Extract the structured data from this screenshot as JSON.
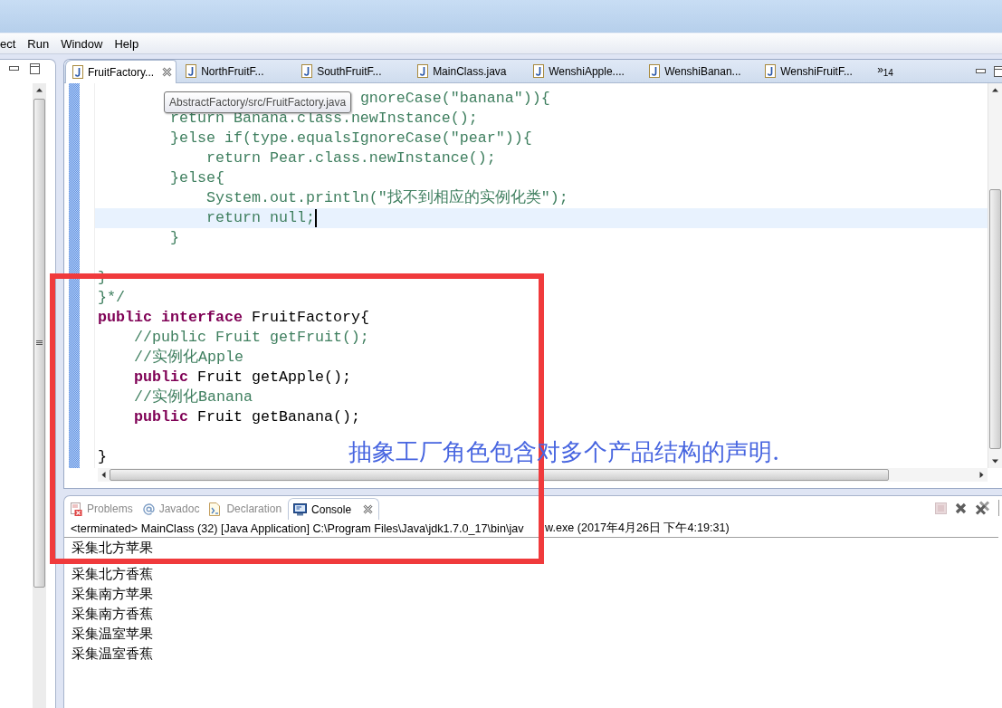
{
  "menu": [
    {
      "label": "ect"
    },
    {
      "label": "Run"
    },
    {
      "label": "Window"
    },
    {
      "label": "Help"
    }
  ],
  "editor": {
    "tabs": [
      {
        "label": "FruitFactory...",
        "selected": true
      },
      {
        "label": "NorthFruitF...",
        "selected": false
      },
      {
        "label": "SouthFruitF...",
        "selected": false
      },
      {
        "label": "MainClass.java",
        "selected": false
      },
      {
        "label": "WenshiApple....",
        "selected": false
      },
      {
        "label": "WenshiBanan...",
        "selected": false
      },
      {
        "label": "WenshiFruitF...",
        "selected": false
      }
    ],
    "overflow": "»$_{14}$",
    "tooltip": "AbstractFactory/src/FruitFactory.java",
    "lines": [
      {
        "highlighted": false,
        "tokens": [
          {
            "kind": "comment",
            "text": "                             gnoreCase(\"banana\")){"
          }
        ]
      },
      {
        "highlighted": false,
        "tokens": [
          {
            "kind": "comment",
            "text": "        return Banana.class.newInstance();"
          }
        ]
      },
      {
        "highlighted": false,
        "tokens": [
          {
            "kind": "comment",
            "text": "        }else if(type.equalsIgnoreCase(\"pear\")){"
          }
        ]
      },
      {
        "highlighted": false,
        "tokens": [
          {
            "kind": "comment",
            "text": "            return Pear.class.newInstance();"
          }
        ]
      },
      {
        "highlighted": false,
        "tokens": [
          {
            "kind": "comment",
            "text": "        }else{"
          }
        ]
      },
      {
        "highlighted": false,
        "tokens": [
          {
            "kind": "comment",
            "text": "            System.out.println(\"找不到相应的实例化类\");"
          }
        ]
      },
      {
        "highlighted": true,
        "tokens": [
          {
            "kind": "comment",
            "text": "            return null;"
          }
        ]
      },
      {
        "highlighted": false,
        "tokens": [
          {
            "kind": "comment",
            "text": "        }"
          }
        ]
      },
      {
        "highlighted": false
      },
      {
        "highlighted": false,
        "tokens": [
          {
            "kind": "comment",
            "text": "}"
          }
        ]
      },
      {
        "highlighted": false,
        "tokens": [
          {
            "kind": "comment",
            "text": "}*/"
          }
        ]
      },
      {
        "highlighted": false,
        "tokens": [
          {
            "kind": "keyword",
            "text": "public"
          },
          {
            "kind": "keyword",
            "text": " interface"
          },
          {
            "kind": "plain",
            "text": " FruitFactory{"
          }
        ]
      },
      {
        "highlighted": false,
        "tokens": [
          {
            "kind": "comment",
            "text": "    //public Fruit getFruit();"
          }
        ]
      },
      {
        "highlighted": false,
        "tokens": [
          {
            "kind": "comment",
            "text": "    //实例化Apple"
          }
        ]
      },
      {
        "highlighted": false,
        "tokens": [
          {
            "kind": "keyword",
            "text": "    public"
          },
          {
            "kind": "plain",
            "text": " Fruit getApple();"
          }
        ]
      },
      {
        "highlighted": false,
        "tokens": [
          {
            "kind": "comment",
            "text": "    //实例化Banana"
          }
        ]
      },
      {
        "highlighted": false,
        "tokens": [
          {
            "kind": "keyword",
            "text": "    public"
          },
          {
            "kind": "plain",
            "text": " Fruit getBanana();"
          }
        ]
      },
      {
        "highlighted": false
      },
      {
        "highlighted": false,
        "tokens": [
          {
            "kind": "plain",
            "text": "}"
          }
        ]
      }
    ]
  },
  "annotation": {
    "text": "抽象工厂角色包含对多个产品结构的声明."
  },
  "console": {
    "tabs": [
      {
        "kind": "problems",
        "label": "Problems",
        "selected": false
      },
      {
        "kind": "javadoc",
        "label": "Javadoc",
        "selected": false
      },
      {
        "kind": "declaration",
        "label": "Declaration",
        "selected": false
      },
      {
        "kind": "console",
        "label": "Console",
        "selected": true
      }
    ],
    "toolbar": [
      {
        "kind": "terminate",
        "disabled": true
      },
      {
        "kind": "remove",
        "disabled": false
      },
      {
        "kind": "remove_all",
        "disabled": false
      }
    ],
    "status": [
      "<terminated> MainClass (32) [Java Application] C:\\Program Files\\Java\\jdk1.7.0_17\\bin\\jav",
      "w.exe (2017年4月26日 下午4:19:31)"
    ],
    "output": [
      "采集北方苹果",
      "采集北方香蕉",
      "采集南方苹果",
      "采集南方香蕉",
      "采集温室苹果",
      "采集温室香蕉"
    ]
  }
}
